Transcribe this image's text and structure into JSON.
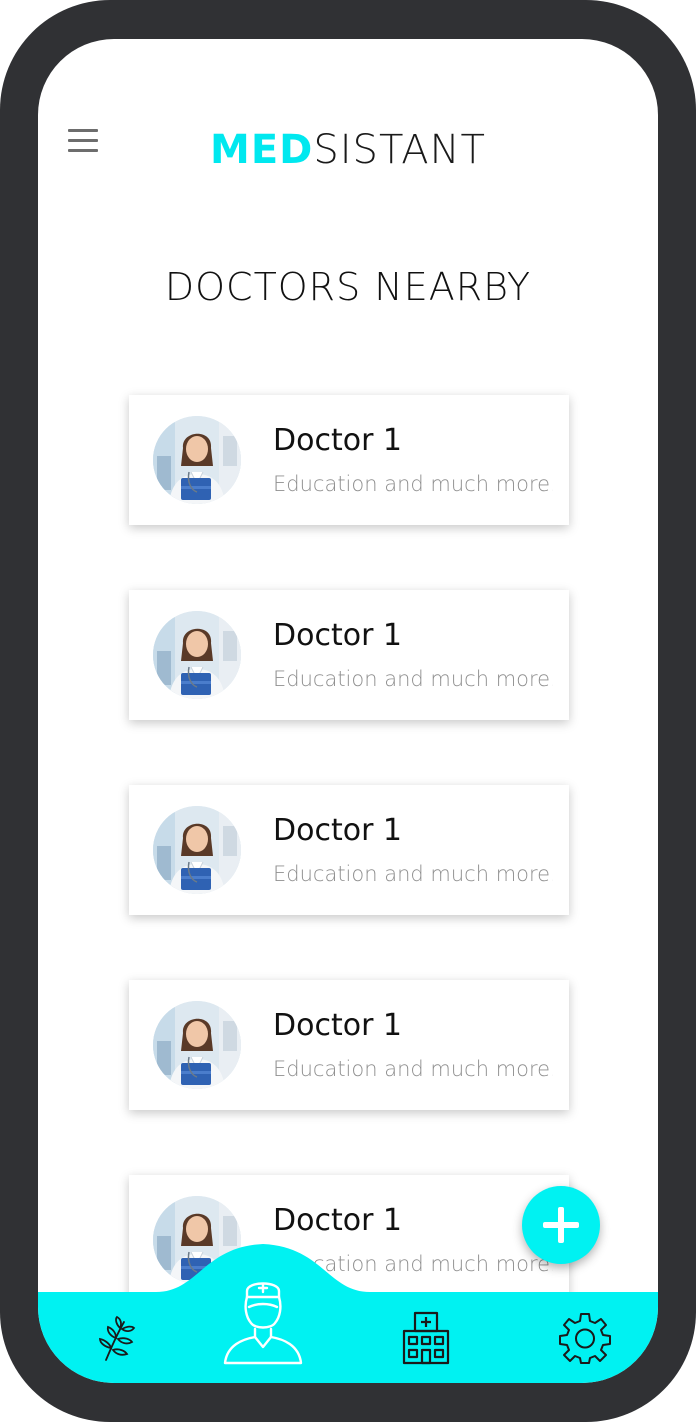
{
  "app": {
    "logo_accent": "MED",
    "logo_rest": "SISTANT",
    "accent_color": "#00f2f2"
  },
  "header": {
    "menu_icon": "hamburger-menu-icon"
  },
  "page": {
    "title": "DOCTORS NEARBY"
  },
  "doctors": [
    {
      "name": "Doctor 1",
      "description": "Education and much more..."
    },
    {
      "name": "Doctor 1",
      "description": "Education and much more..."
    },
    {
      "name": "Doctor 1",
      "description": "Education and much more..."
    },
    {
      "name": "Doctor 1",
      "description": "Education and much more..."
    },
    {
      "name": "Doctor 1",
      "description": "Education and much more..."
    }
  ],
  "fab": {
    "icon": "plus-icon"
  },
  "bottom_nav": [
    {
      "icon": "plant-icon"
    },
    {
      "icon": "nurse-icon",
      "active": true
    },
    {
      "icon": "hospital-icon"
    },
    {
      "icon": "gear-icon"
    }
  ]
}
